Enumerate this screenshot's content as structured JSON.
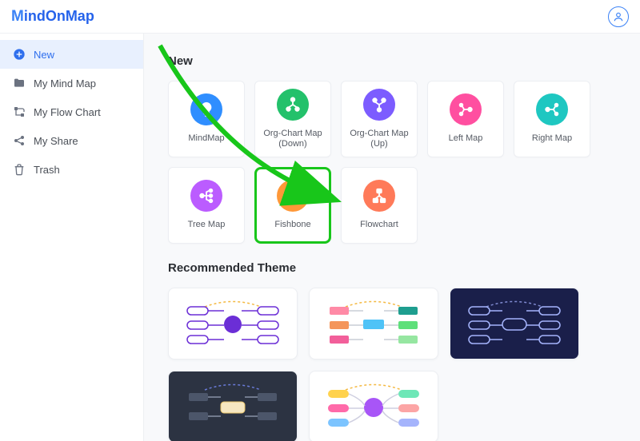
{
  "logo": {
    "brand_m": "M",
    "brand_rest": "indOnMap"
  },
  "sidebar": {
    "items": [
      {
        "icon": "plus-circle",
        "label": "New",
        "active": true
      },
      {
        "icon": "folder",
        "label": "My Mind Map",
        "active": false
      },
      {
        "icon": "flow",
        "label": "My Flow Chart",
        "active": false
      },
      {
        "icon": "share",
        "label": "My Share",
        "active": false
      },
      {
        "icon": "trash",
        "label": "Trash",
        "active": false
      }
    ]
  },
  "sections": {
    "new_title": "New",
    "theme_title": "Recommended Theme"
  },
  "templates": [
    {
      "label": "MindMap",
      "color": "#2f8eff",
      "icon": "bulb"
    },
    {
      "label": "Org-Chart Map (Down)",
      "color": "#23c16b",
      "icon": "org-down"
    },
    {
      "label": "Org-Chart Map (Up)",
      "color": "#7c5cff",
      "icon": "org-up"
    },
    {
      "label": "Left Map",
      "color": "#ff4fa0",
      "icon": "left"
    },
    {
      "label": "Right Map",
      "color": "#1ec7c1",
      "icon": "right"
    },
    {
      "label": "Tree Map",
      "color": "#bb5cff",
      "icon": "tree"
    },
    {
      "label": "Fishbone",
      "color": "#ff9838",
      "icon": "fishbone",
      "highlight": true
    },
    {
      "label": "Flowchart",
      "color": "#ff7a59",
      "icon": "flowchart"
    }
  ],
  "themes": [
    {
      "bg": "#ffffff",
      "accent": "#6b2ed6",
      "style": "nodes-purple"
    },
    {
      "bg": "#ffffff",
      "accent": "#4fc3f7",
      "style": "blocks-colorful"
    },
    {
      "bg": "#1a1f4a",
      "accent": "#a5b4fc",
      "style": "nodes-dark"
    },
    {
      "bg": "#2c3342",
      "accent": "#e9c46a",
      "style": "blocks-dark"
    },
    {
      "bg": "#ffffff",
      "accent": "#a855f7",
      "style": "radial-colorful"
    }
  ],
  "annotation": {
    "arrow_color": "#18c61a",
    "target": "Fishbone"
  }
}
